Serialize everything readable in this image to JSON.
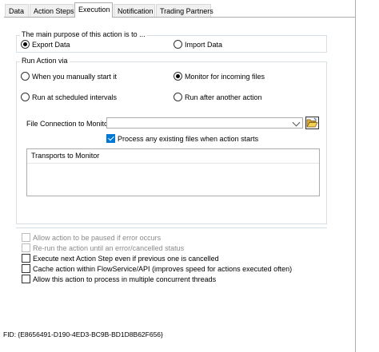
{
  "tabs": [
    {
      "label": "Data",
      "active": false
    },
    {
      "label": "Action Steps",
      "active": false
    },
    {
      "label": "Execution",
      "active": true
    },
    {
      "label": "Notification",
      "active": false
    },
    {
      "label": "Trading Partners",
      "active": false
    }
  ],
  "purpose": {
    "legend": "The main purpose of this action is to ...",
    "options": [
      {
        "label": "Export Data",
        "selected": true
      },
      {
        "label": "Import Data",
        "selected": false
      }
    ]
  },
  "run_via": {
    "legend": "Run Action via",
    "options": [
      {
        "label": "When you manually start it",
        "selected": false
      },
      {
        "label": "Monitor for incoming files",
        "selected": true
      },
      {
        "label": "Run at scheduled intervals",
        "selected": false
      },
      {
        "label": "Run after another action",
        "selected": false
      }
    ]
  },
  "monitor": {
    "file_connection_label": "File Connection to Monitor",
    "file_connection_value": "",
    "process_existing_label": "Process any existing files when action starts",
    "process_existing_checked": true,
    "transports_header": "Transports to Monitor"
  },
  "options": [
    {
      "label": "Allow action to be paused if error occurs",
      "checked": false,
      "enabled": false
    },
    {
      "label": "Re-run the action until an error/cancelled status",
      "checked": false,
      "enabled": false
    },
    {
      "label": "Execute next Action Step even if previous one is cancelled",
      "checked": false,
      "enabled": true
    },
    {
      "label": "Cache action within FlowService/API (improves speed for actions executed often)",
      "checked": false,
      "enabled": true
    },
    {
      "label": "Allow this action to process in multiple concurrent threads",
      "checked": false,
      "enabled": true
    }
  ],
  "fid": "FID: {E8656491-D190-4ED3-BC9B-BD1D8B62F656}",
  "icons": {
    "browse": "folder-open-icon",
    "dropdown": "chevron-down-icon"
  }
}
